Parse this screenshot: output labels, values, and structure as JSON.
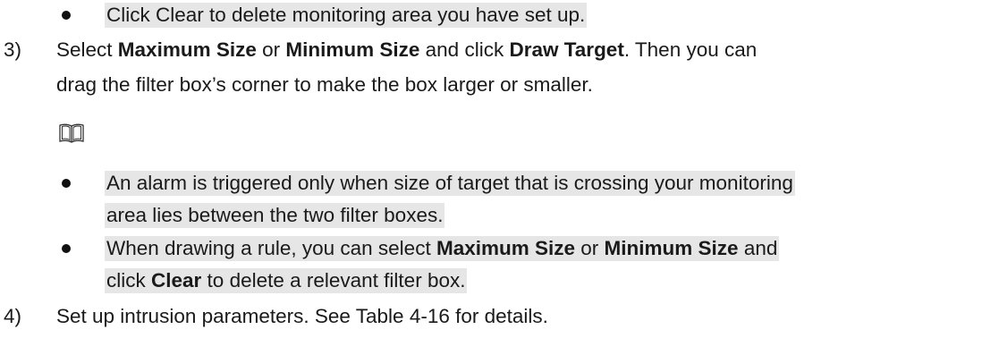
{
  "lines": {
    "b1": "Click Clear to delete monitoring area you have set up.",
    "s3_num": "3)",
    "s3_a": "Select ",
    "s3_b1": "Maximum Size",
    "s3_c": " or ",
    "s3_b2": "Minimum Size",
    "s3_d": " and click ",
    "s3_b3": "Draw Target",
    "s3_e": ". Then you can",
    "s3_l2": "drag the filter box’s corner to make the box larger or smaller.",
    "n1_l1": "An alarm is triggered only when size of target that is crossing your monitoring",
    "n1_l2": "area lies between the two filter boxes.",
    "n2_a": "When drawing a rule, you can select ",
    "n2_b1": "Maximum Size",
    "n2_c": " or ",
    "n2_b2": "Minimum Size",
    "n2_d": " and",
    "n2_l2a": "click ",
    "n2_l2b": "Clear",
    "n2_l2c": " to delete a relevant filter box.",
    "s4_num": "4)",
    "s4_text": "Set up intrusion parameters. See Table 4-16 for details."
  },
  "icons": {
    "note": "book-icon"
  }
}
